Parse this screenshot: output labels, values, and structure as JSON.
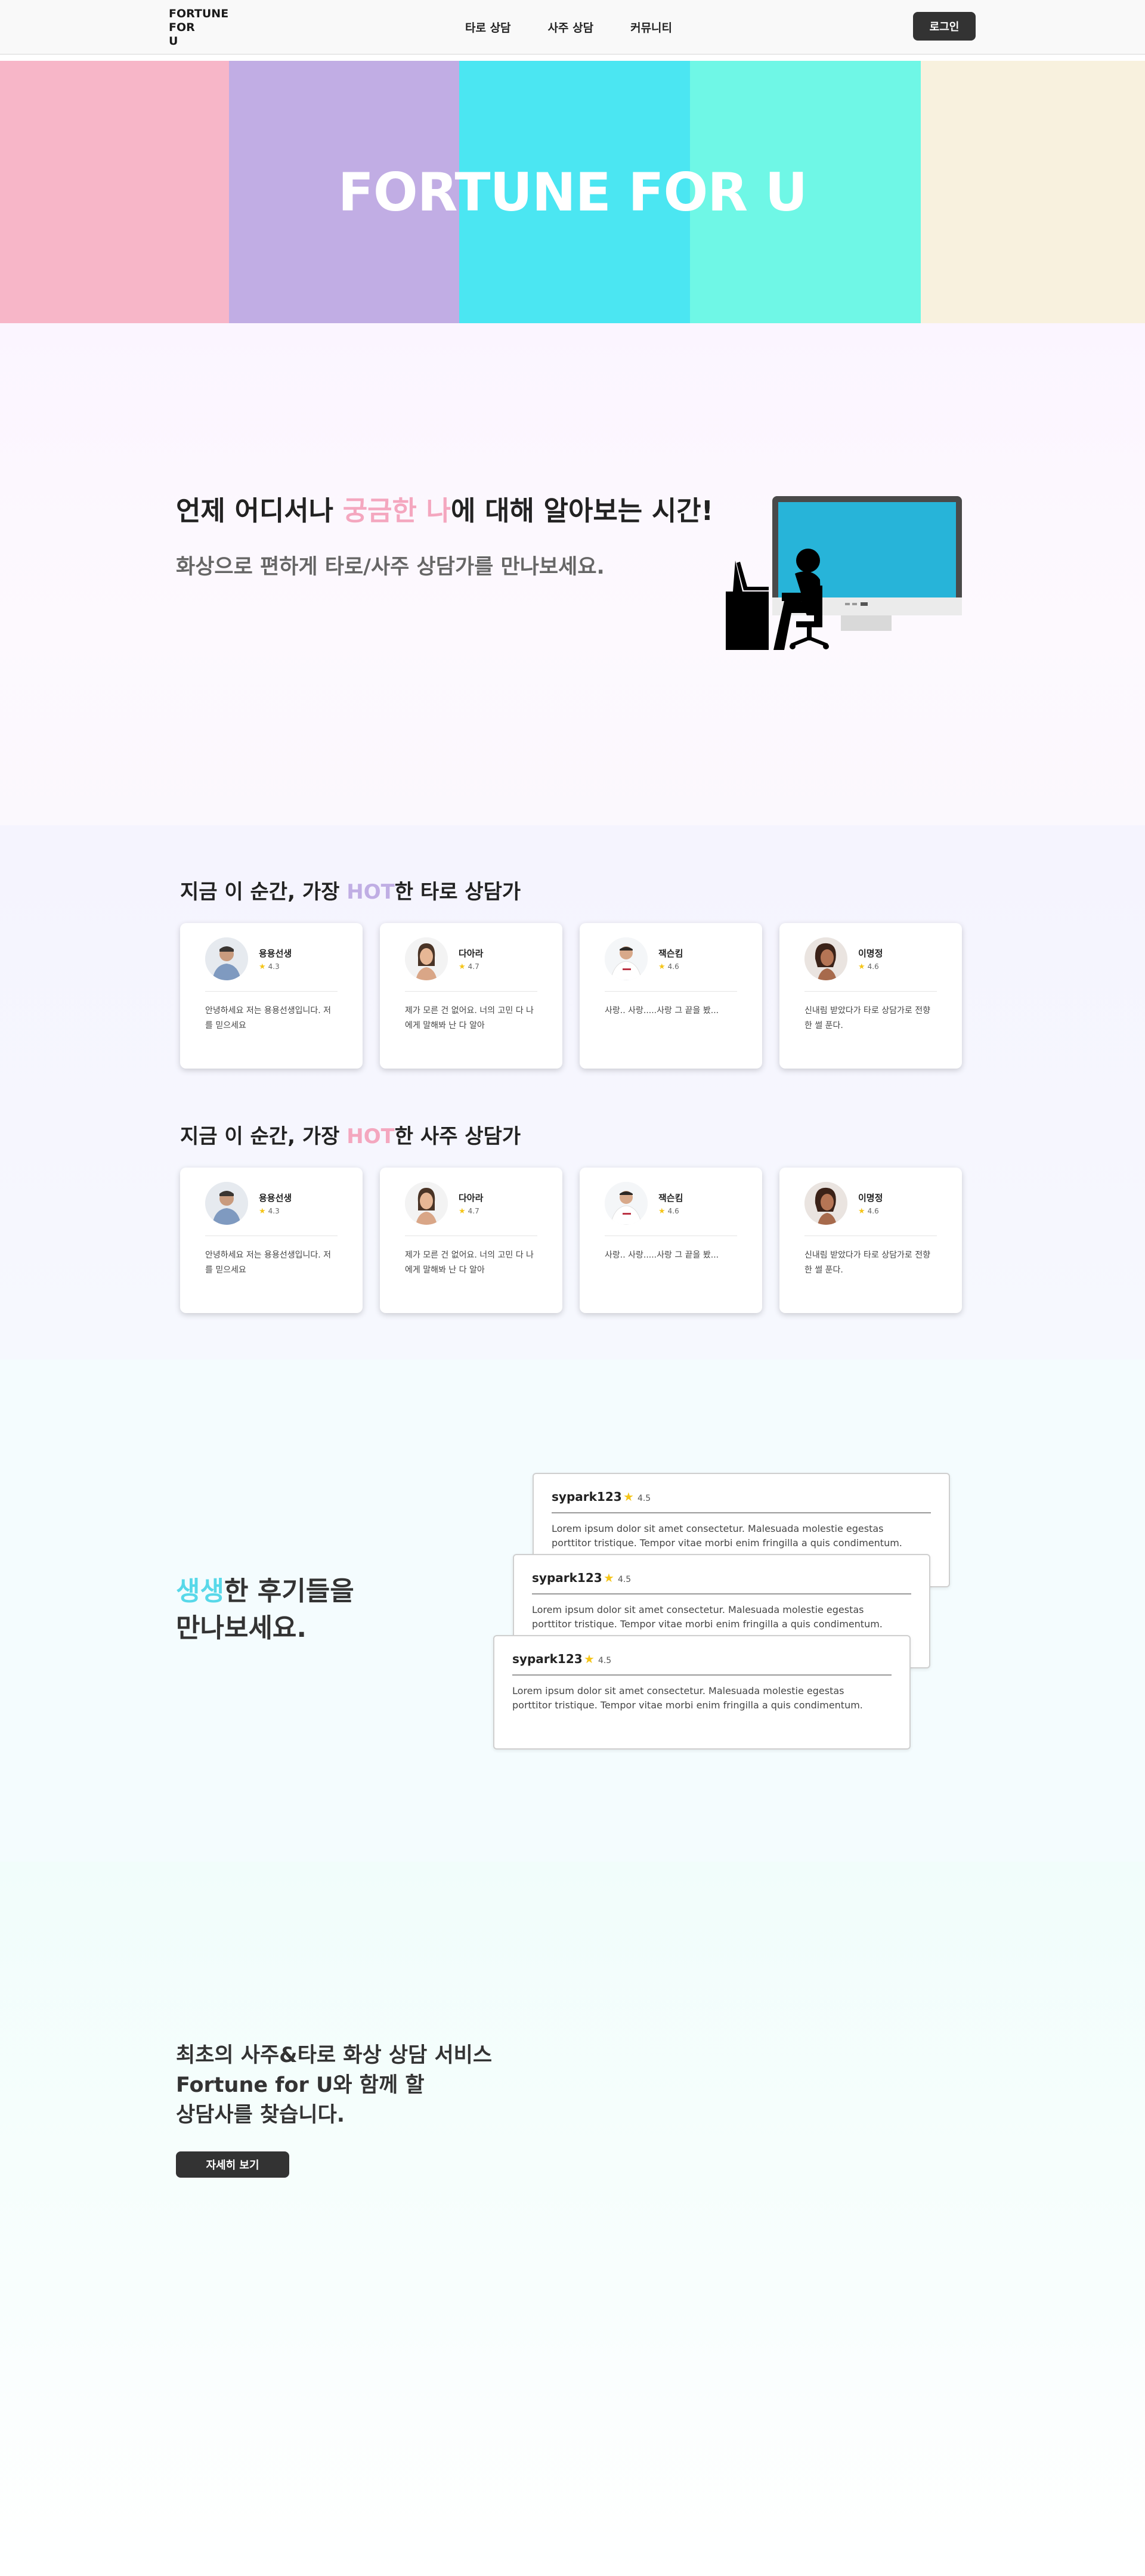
{
  "header": {
    "logo": "FORTUNE\nFOR\nU",
    "nav": [
      "타로 상담",
      "사주 상담",
      "커뮤니티"
    ],
    "login_label": "로그인"
  },
  "hero": {
    "title": "FORTUNE FOR U",
    "stripe_colors": [
      "#f7b6c8",
      "#c1ade4",
      "#4be6f2",
      "#6ff7e6",
      "#f8f1de"
    ]
  },
  "intro": {
    "headline_pre": "언제 어디서나 ",
    "headline_accent": "궁금한 나",
    "headline_post": "에 대해 알아보는 시간!",
    "subline": "화상으로 편하게 타로/사주 상담가를 만나보세요."
  },
  "hot_tarot": {
    "title_pre": "지금 이 순간, 가장 ",
    "title_accent": "HOT",
    "title_post": "한 타로 상담가",
    "counselors": [
      {
        "name": "용용선생",
        "rating": "4.3",
        "desc": "안녕하세요 저는 용용선생입니다. 저를 믿으세요"
      },
      {
        "name": "다아라",
        "rating": "4.7",
        "desc": "제가 모른 건 없어요. 너의 고민 다 나에게 말해봐 난 다 알아"
      },
      {
        "name": "잭슨킴",
        "rating": "4.6",
        "desc": "사랑.. 사랑.....사랑 그 끝을 봤..."
      },
      {
        "name": "이명정",
        "rating": "4.6",
        "desc": "신내림 받았다가 타로 상담가로 전향한 썰 푼다."
      }
    ]
  },
  "hot_saju": {
    "title_pre": "지금 이 순간, 가장 ",
    "title_accent": "HOT",
    "title_post": "한 사주 상담가",
    "counselors": [
      {
        "name": "용용선생",
        "rating": "4.3",
        "desc": "안녕하세요 저는 용용선생입니다. 저를 믿으세요"
      },
      {
        "name": "다아라",
        "rating": "4.7",
        "desc": "제가 모른 건 없어요. 너의 고민 다 나에게 말해봐 난 다 알아"
      },
      {
        "name": "잭슨킴",
        "rating": "4.6",
        "desc": "사랑.. 사랑.....사랑 그 끝을 봤..."
      },
      {
        "name": "이명정",
        "rating": "4.6",
        "desc": "신내림 받았다가 타로 상담가로 전향한 썰 푼다."
      }
    ]
  },
  "reviews": {
    "head_accent": "생생",
    "head_line1_rest": "한 후기들을",
    "head_line2": "만나보세요.",
    "items": [
      {
        "user": "sypark123",
        "rating": "4.5",
        "text": "Lorem ipsum dolor sit amet consectetur. Malesuada molestie egestas porttitor tristique. Tempor vitae morbi enim fringilla a quis condimentum."
      },
      {
        "user": "sypark123",
        "rating": "4.5",
        "text": "Lorem ipsum dolor sit amet consectetur. Malesuada molestie egestas porttitor tristique. Tempor vitae morbi enim fringilla a quis condimentum."
      },
      {
        "user": "sypark123",
        "rating": "4.5",
        "text": "Lorem ipsum dolor sit amet consectetur. Malesuada molestie egestas porttitor tristique. Tempor vitae morbi enim fringilla a quis condimentum."
      }
    ]
  },
  "cta": {
    "headline": "최초의 사주&타로  화상 상담 서비스\nFortune for U와 함께 할\n상담사를 찾습니다.",
    "button_label": "자세히 보기"
  },
  "colors": {
    "accent_pink": "#f4a7bf",
    "accent_purple": "#c0aee4",
    "accent_cyan": "#58d8e9",
    "dark_button": "#333333"
  }
}
